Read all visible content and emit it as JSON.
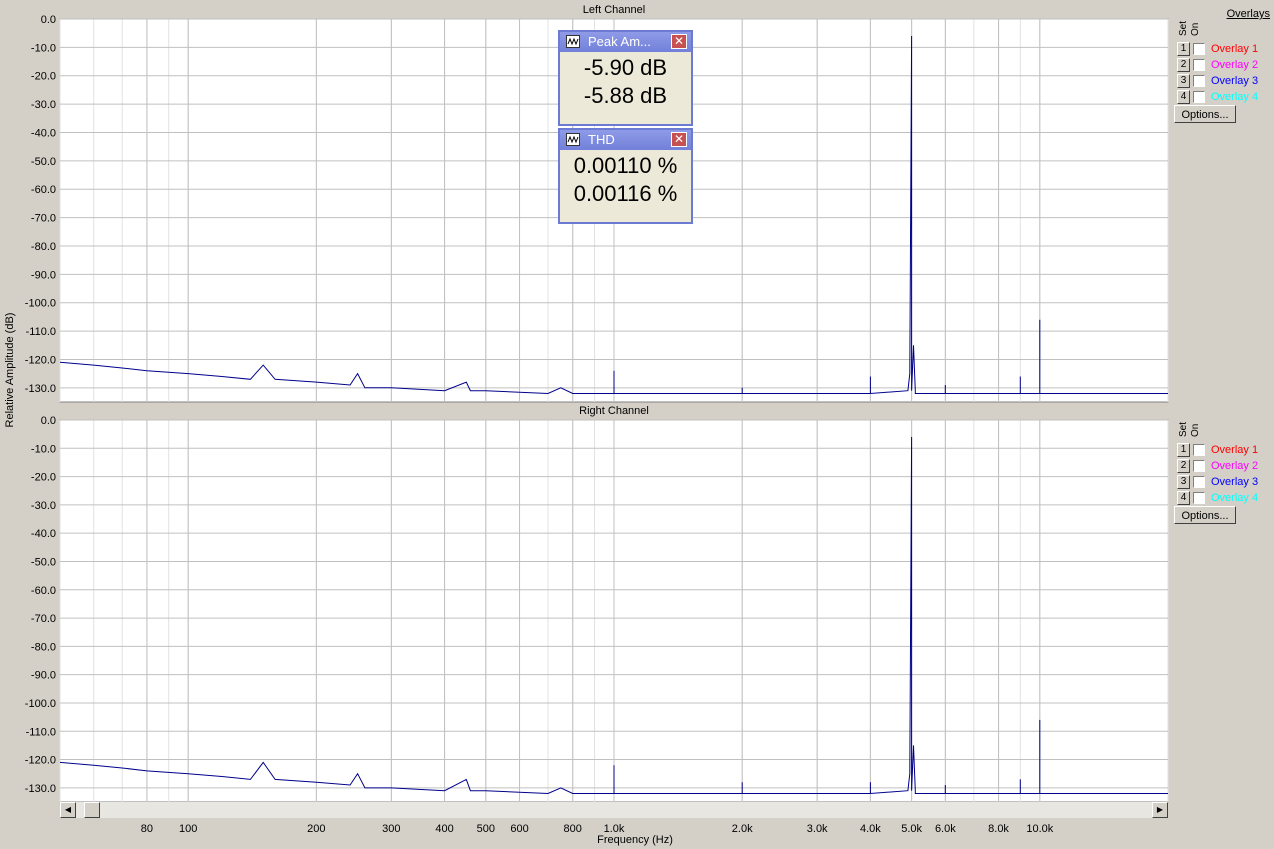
{
  "window": {
    "ylabel": "Relative Amplitude (dB)",
    "xlabel": "Frequency (Hz)"
  },
  "panels": [
    {
      "title": "Left Channel"
    },
    {
      "title": "Right Channel"
    }
  ],
  "overlays": {
    "title": "Overlays",
    "set_label": "Set",
    "on_label": "On",
    "items": [
      {
        "num": "1",
        "label": "Overlay 1",
        "color": "#ff0000"
      },
      {
        "num": "2",
        "label": "Overlay 2",
        "color": "#ff00ff"
      },
      {
        "num": "3",
        "label": "Overlay 3",
        "color": "#0000ff"
      },
      {
        "num": "4",
        "label": "Overlay 4",
        "color": "#00ffff"
      }
    ],
    "options_label": "Options..."
  },
  "meters": {
    "peak": {
      "title": "Peak Am...",
      "values": [
        "-5.90 dB",
        "-5.88 dB"
      ]
    },
    "thd": {
      "title": "THD",
      "values": [
        "0.00110 %",
        "0.00116 %"
      ]
    }
  },
  "colors": {
    "trace": "#00008b",
    "grid": "#c0c0c0",
    "plot_bg": "#ffffff"
  },
  "chart_data": [
    {
      "type": "line",
      "title": "Left Channel",
      "xlabel": "Frequency (Hz)",
      "ylabel": "Relative Amplitude (dB)",
      "xscale": "log",
      "xlim": [
        50,
        20000
      ],
      "ylim": [
        -135,
        0
      ],
      "yticks": [
        0,
        -10,
        -20,
        -30,
        -40,
        -50,
        -60,
        -70,
        -80,
        -90,
        -100,
        -110,
        -120,
        -130
      ],
      "xticks": [
        80,
        100,
        200,
        300,
        400,
        500,
        600,
        800,
        1000,
        2000,
        3000,
        4000,
        5000,
        6000,
        8000,
        10000
      ],
      "xtick_labels": [
        "80",
        "100",
        "200",
        "300",
        "400",
        "500",
        "600",
        "800",
        "1.0k",
        "2.0k",
        "3.0k",
        "4.0k",
        "5.0k",
        "6.0k",
        "8.0k",
        "10.0k"
      ],
      "grid": true,
      "series": [
        {
          "x": [
            50,
            60,
            70,
            80,
            100,
            120,
            140,
            150,
            160,
            200,
            240,
            250,
            260,
            300,
            400,
            450,
            460,
            500,
            700,
            750,
            800,
            1000,
            1000,
            1000,
            1200,
            2000,
            2000,
            2000,
            3000,
            4000,
            4000,
            4000,
            4900,
            4950,
            5000,
            5000,
            5050,
            5100,
            5100,
            6000,
            6000,
            6000,
            8000,
            9000,
            9000,
            9000,
            10000,
            10000,
            10000,
            12000,
            15000,
            20000
          ],
          "y": [
            -121,
            -122,
            -123,
            -124,
            -125,
            -126,
            -127,
            -122,
            -127,
            -128,
            -129,
            -125,
            -130,
            -130,
            -131,
            -128,
            -131,
            -131,
            -132,
            -130,
            -132,
            -132,
            -124,
            -132,
            -132,
            -132,
            -130,
            -132,
            -132,
            -132,
            -126,
            -132,
            -131,
            -125,
            -6,
            -131,
            -115,
            -131,
            -132,
            -132,
            -129,
            -132,
            -132,
            -132,
            -126,
            -132,
            -132,
            -106,
            -132,
            -132,
            -132,
            -132
          ]
        }
      ]
    },
    {
      "type": "line",
      "title": "Right Channel",
      "xlabel": "Frequency (Hz)",
      "ylabel": "Relative Amplitude (dB)",
      "xscale": "log",
      "xlim": [
        50,
        20000
      ],
      "ylim": [
        -135,
        0
      ],
      "yticks": [
        0,
        -10,
        -20,
        -30,
        -40,
        -50,
        -60,
        -70,
        -80,
        -90,
        -100,
        -110,
        -120,
        -130
      ],
      "xticks": [
        80,
        100,
        200,
        300,
        400,
        500,
        600,
        800,
        1000,
        2000,
        3000,
        4000,
        5000,
        6000,
        8000,
        10000
      ],
      "xtick_labels": [
        "80",
        "100",
        "200",
        "300",
        "400",
        "500",
        "600",
        "800",
        "1.0k",
        "2.0k",
        "3.0k",
        "4.0k",
        "5.0k",
        "6.0k",
        "8.0k",
        "10.0k"
      ],
      "grid": true,
      "series": [
        {
          "x": [
            50,
            60,
            70,
            80,
            100,
            120,
            140,
            150,
            160,
            200,
            240,
            250,
            260,
            300,
            400,
            450,
            460,
            500,
            700,
            750,
            800,
            1000,
            1000,
            1000,
            1200,
            2000,
            2000,
            2000,
            3000,
            4000,
            4000,
            4000,
            4900,
            4950,
            5000,
            5000,
            5050,
            5100,
            5100,
            6000,
            6000,
            6000,
            8000,
            9000,
            9000,
            9000,
            10000,
            10000,
            10000,
            12000,
            15000,
            20000
          ],
          "y": [
            -121,
            -122,
            -123,
            -124,
            -125,
            -126,
            -127,
            -121,
            -127,
            -128,
            -129,
            -125,
            -130,
            -130,
            -131,
            -127,
            -131,
            -131,
            -132,
            -130,
            -132,
            -132,
            -122,
            -132,
            -132,
            -132,
            -128,
            -132,
            -132,
            -132,
            -128,
            -132,
            -131,
            -125,
            -6,
            -131,
            -115,
            -131,
            -132,
            -132,
            -129,
            -132,
            -132,
            -132,
            -127,
            -132,
            -132,
            -106,
            -132,
            -132,
            -132,
            -132
          ]
        }
      ]
    }
  ]
}
